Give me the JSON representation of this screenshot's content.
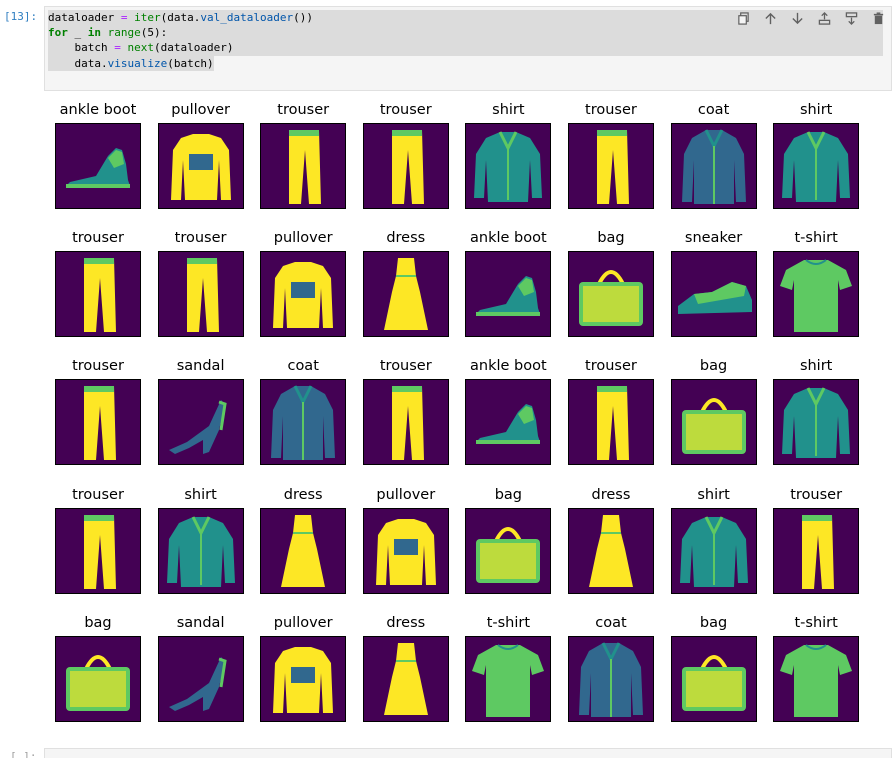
{
  "cell": {
    "prompt": "[13]:",
    "next_prompt": "[ ]:",
    "code": {
      "l1_a": "dataloader ",
      "l1_op": "=",
      "l1_sp": " ",
      "l1_iter": "iter",
      "l1_b": "(data.",
      "l1_attr": "val_dataloader",
      "l1_c": "())",
      "l2_for": "for",
      "l2_a": " _ ",
      "l2_in": "in",
      "l2_sp": " ",
      "l2_range": "range",
      "l2_b": "(5):",
      "l3_a": "    batch ",
      "l3_op": "=",
      "l3_sp": " ",
      "l3_next": "next",
      "l3_b": "(dataloader)",
      "l4_a": "    data.",
      "l4_attr": "visualize",
      "l4_b": "(batch)"
    }
  },
  "toolbar": {
    "buttons": [
      "copy-icon",
      "arrow-up-icon",
      "arrow-down-icon",
      "insert-above-icon",
      "insert-below-icon",
      "delete-icon"
    ]
  },
  "colors": {
    "viridis_dark": "#440154",
    "viridis_blue": "#31688e",
    "viridis_teal": "#21918c",
    "viridis_green": "#5ec962",
    "viridis_yellow": "#fde725",
    "prompt": "#307fc1"
  },
  "grid": {
    "rows": [
      [
        "ankle boot",
        "pullover",
        "trouser",
        "trouser",
        "shirt",
        "trouser",
        "coat",
        "shirt"
      ],
      [
        "trouser",
        "trouser",
        "pullover",
        "dress",
        "ankle boot",
        "bag",
        "sneaker",
        "t-shirt"
      ],
      [
        "trouser",
        "sandal",
        "coat",
        "trouser",
        "ankle boot",
        "trouser",
        "bag",
        "shirt"
      ],
      [
        "trouser",
        "shirt",
        "dress",
        "pullover",
        "bag",
        "dress",
        "shirt",
        "trouser"
      ],
      [
        "bag",
        "sandal",
        "pullover",
        "dress",
        "t-shirt",
        "coat",
        "bag",
        "t-shirt"
      ]
    ]
  }
}
